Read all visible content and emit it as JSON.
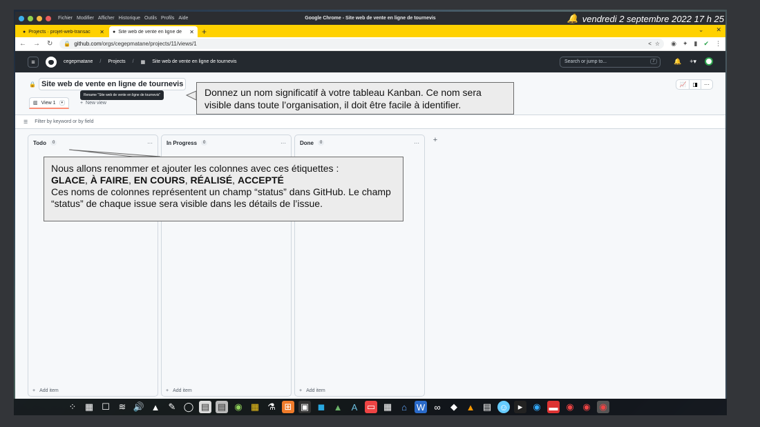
{
  "system": {
    "clock": "vendredi 2 septembre 2022  17 h 25",
    "menu": [
      "Fichier",
      "Modifier",
      "Afficher",
      "Historique",
      "Outils",
      "Profils",
      "Aide"
    ],
    "window_title": "Google Chrome - Site web de vente en ligne de tournevis"
  },
  "browser": {
    "tabs": [
      {
        "label": "Projects · projet-web-transac"
      },
      {
        "label": "Site web de vente en ligne de"
      }
    ],
    "url_host": "github.com",
    "url_path": "/orgs/cegepmatane/projects/11/views/1"
  },
  "github": {
    "org": "cegepmatane",
    "projects_link": "Projects",
    "project_name": "Site web de vente en ligne de tournevis",
    "search_placeholder": "Search or jump to...",
    "search_key": "/"
  },
  "project": {
    "title_field": "Site web de vente en ligne de tournevis",
    "rename_tooltip": "Rename \"Site web de vente en ligne de tournevis\"",
    "view_tab": "View 1",
    "new_view": "New view",
    "filter_placeholder": "Filter by keyword or by field"
  },
  "board": {
    "columns": [
      {
        "name": "Todo",
        "count": "0",
        "add": "Add item"
      },
      {
        "name": "In Progress",
        "count": "0",
        "add": "Add item"
      },
      {
        "name": "Done",
        "count": "0",
        "add": "Add item"
      }
    ]
  },
  "callouts": {
    "c1": "Donnez un nom significatif à votre tableau Kanban.  Ce nom sera visible dans toute l’organisation, il doit être facile à identifier.",
    "c2_intro": "Nous allons renommer et ajouter les colonnes avec ces étiquettes :",
    "c2_labels": [
      "GLACE",
      "À FAIRE",
      "EN COURS",
      "RÉALISÉ",
      "ACCEPTÉ"
    ],
    "c2_sep": ", ",
    "c2_body": "Ces noms de colonnes représentent un champ “status” dans GitHub. Le champ “status” de chaque issue sera visible dans les détails de l’issue."
  },
  "colors": {
    "tabbar": "#ffd100",
    "gh_header": "#24292f",
    "callout_bg": "#ececec"
  }
}
